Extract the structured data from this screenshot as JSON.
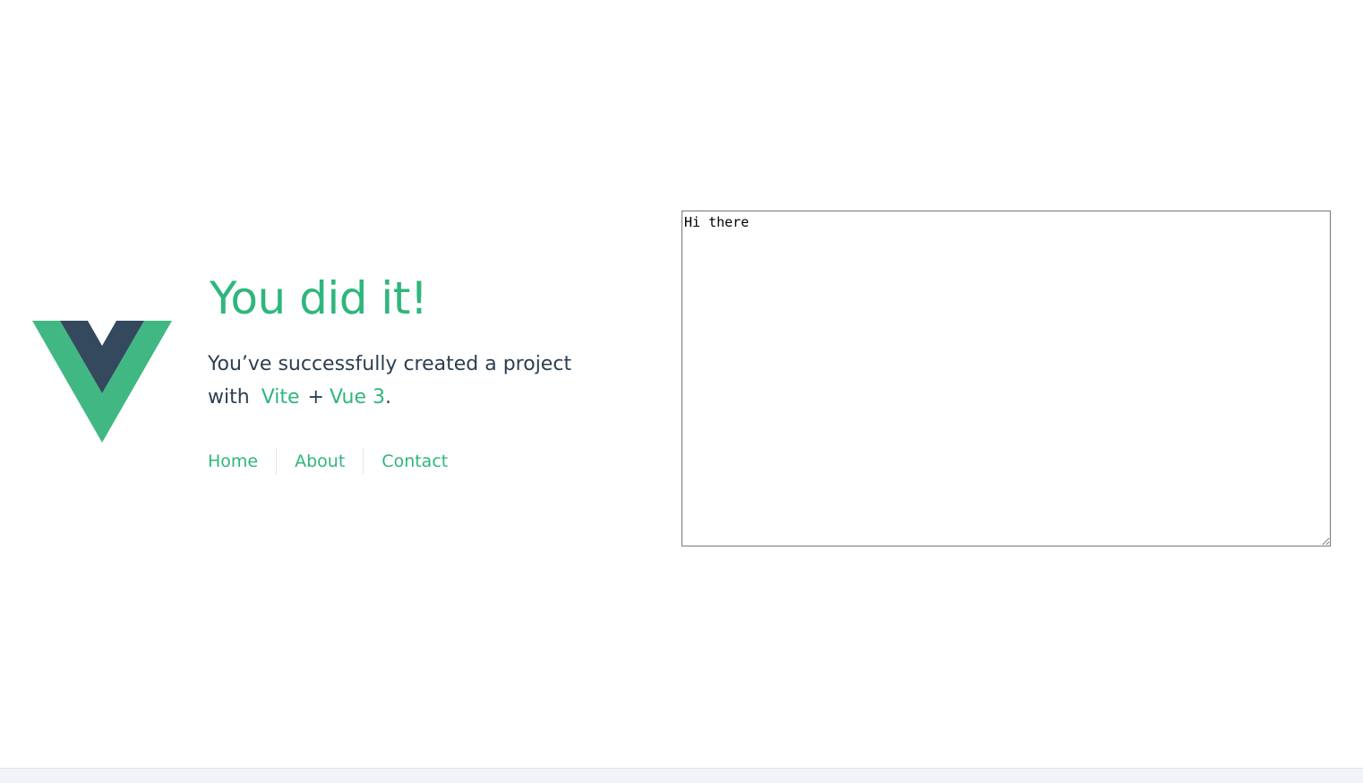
{
  "hero": {
    "title": "You did it!",
    "subtitle_prefix": "You’ve successfully created a project with",
    "link_vite": "Vite",
    "plus": "+",
    "link_vue": "Vue 3",
    "period": "."
  },
  "nav": {
    "items": [
      {
        "label": "Home"
      },
      {
        "label": "About"
      },
      {
        "label": "Contact"
      }
    ]
  },
  "editor": {
    "value": "Hi there"
  },
  "colors": {
    "accent": "#2fb67c",
    "logo_outer": "#41b883",
    "logo_inner": "#34495e",
    "text": "#2c3e50"
  }
}
